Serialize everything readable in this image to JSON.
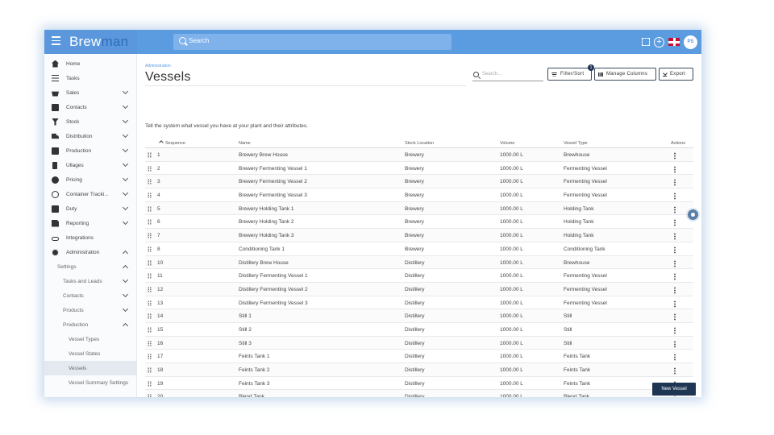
{
  "topbar": {
    "brand_main": "Brew",
    "brand_accent": "man",
    "search_label": "Search",
    "avatar_initials": "PS"
  },
  "sidebar": {
    "items": [
      {
        "label": "Home",
        "icon": "home-icon"
      },
      {
        "label": "Tasks",
        "icon": "list-icon"
      },
      {
        "label": "Sales",
        "icon": "basket-icon"
      },
      {
        "label": "Contacts",
        "icon": "contacts-icon"
      },
      {
        "label": "Stock",
        "icon": "funnel-icon"
      },
      {
        "label": "Distribution",
        "icon": "truck-icon"
      },
      {
        "label": "Production",
        "icon": "production-icon"
      },
      {
        "label": "Ullages",
        "icon": "ullage-icon"
      },
      {
        "label": "Pricing",
        "icon": "pricing-icon"
      },
      {
        "label": "Container Tracki...",
        "icon": "target-icon"
      },
      {
        "label": "Duty",
        "icon": "duty-icon"
      },
      {
        "label": "Reporting",
        "icon": "report-icon"
      },
      {
        "label": "Integrations",
        "icon": "link-icon"
      },
      {
        "label": "Administration",
        "icon": "gear-icon"
      },
      {
        "label": "Settings"
      },
      {
        "label": "Tasks and Leads"
      },
      {
        "label": "Contacts"
      },
      {
        "label": "Products"
      },
      {
        "label": "Production"
      },
      {
        "label": "Vessel Types"
      },
      {
        "label": "Vessel States"
      },
      {
        "label": "Vessels"
      },
      {
        "label": "Vessel Summary Settings"
      }
    ]
  },
  "main": {
    "breadcrumb": "Administration",
    "title": "Vessels",
    "search_placeholder": "Search...",
    "filter_label": "Filter/Sort",
    "filter_badge": "1",
    "columns_label": "Manage Columns",
    "export_label": "Export",
    "description": "Tell the system what vessel you have at your plant and their attributes.",
    "new_button": "New Vessel"
  },
  "table": {
    "headers": {
      "sequence": "Sequence",
      "name": "Name",
      "location": "Stock Location",
      "volume": "Volume",
      "type": "Vessel Type",
      "actions": "Actions"
    },
    "rows": [
      {
        "seq": "1",
        "name": "Brewery Brew House",
        "loc": "Brewery",
        "vol": "1000.00 L",
        "type": "Brewhouse"
      },
      {
        "seq": "2",
        "name": "Brewery Fermenting Vessel 1",
        "loc": "Brewery",
        "vol": "1000.00 L",
        "type": "Fermenting Vessel"
      },
      {
        "seq": "3",
        "name": "Brewery Fermenting Vessel 2",
        "loc": "Brewery",
        "vol": "1000.00 L",
        "type": "Fermenting Vessel"
      },
      {
        "seq": "4",
        "name": "Brewery Fermenting Vessel 3",
        "loc": "Brewery",
        "vol": "1000.00 L",
        "type": "Fermenting Vessel"
      },
      {
        "seq": "5",
        "name": "Brewery Holding Tank 1",
        "loc": "Brewery",
        "vol": "1000.00 L",
        "type": "Holding Tank"
      },
      {
        "seq": "6",
        "name": "Brewery Holding Tank 2",
        "loc": "Brewery",
        "vol": "1000.00 L",
        "type": "Holding Tank"
      },
      {
        "seq": "7",
        "name": "Brewery Holding Tank 3",
        "loc": "Brewery",
        "vol": "1000.00 L",
        "type": "Holding Tank"
      },
      {
        "seq": "8",
        "name": "Conditioning Tank 1",
        "loc": "Brewery",
        "vol": "1000.00 L",
        "type": "Conditioning Tank"
      },
      {
        "seq": "10",
        "name": "Distillery Brew House",
        "loc": "Distillery",
        "vol": "1000.00 L",
        "type": "Brewhouse"
      },
      {
        "seq": "11",
        "name": "Distillery Fermenting Vessel 1",
        "loc": "Distillery",
        "vol": "1000.00 L",
        "type": "Fermenting Vessel"
      },
      {
        "seq": "12",
        "name": "Distillery Fermenting Vessel 2",
        "loc": "Distillery",
        "vol": "1000.00 L",
        "type": "Fermenting Vessel"
      },
      {
        "seq": "13",
        "name": "Distillery Fermenting Vessel 3",
        "loc": "Distillery",
        "vol": "1000.00 L",
        "type": "Fermenting Vessel"
      },
      {
        "seq": "14",
        "name": "Still 1",
        "loc": "Distillery",
        "vol": "1000.00 L",
        "type": "Still"
      },
      {
        "seq": "15",
        "name": "Still 2",
        "loc": "Distillery",
        "vol": "1000.00 L",
        "type": "Still"
      },
      {
        "seq": "16",
        "name": "Still 3",
        "loc": "Distillery",
        "vol": "1000.00 L",
        "type": "Still"
      },
      {
        "seq": "17",
        "name": "Feints Tank 1",
        "loc": "Distillery",
        "vol": "1000.00 L",
        "type": "Feints Tank"
      },
      {
        "seq": "18",
        "name": "Feints Tank 2",
        "loc": "Distillery",
        "vol": "1000.00 L",
        "type": "Feints Tank"
      },
      {
        "seq": "19",
        "name": "Feints Tank 3",
        "loc": "Distillery",
        "vol": "1000.00 L",
        "type": "Feints Tank"
      },
      {
        "seq": "20",
        "name": "Blend Tank",
        "loc": "Distillery",
        "vol": "1000.00 L",
        "type": "Blend Tank"
      }
    ]
  },
  "colors": {
    "brand_blue": "#5b9be0",
    "primary_dark": "#1e3553"
  }
}
